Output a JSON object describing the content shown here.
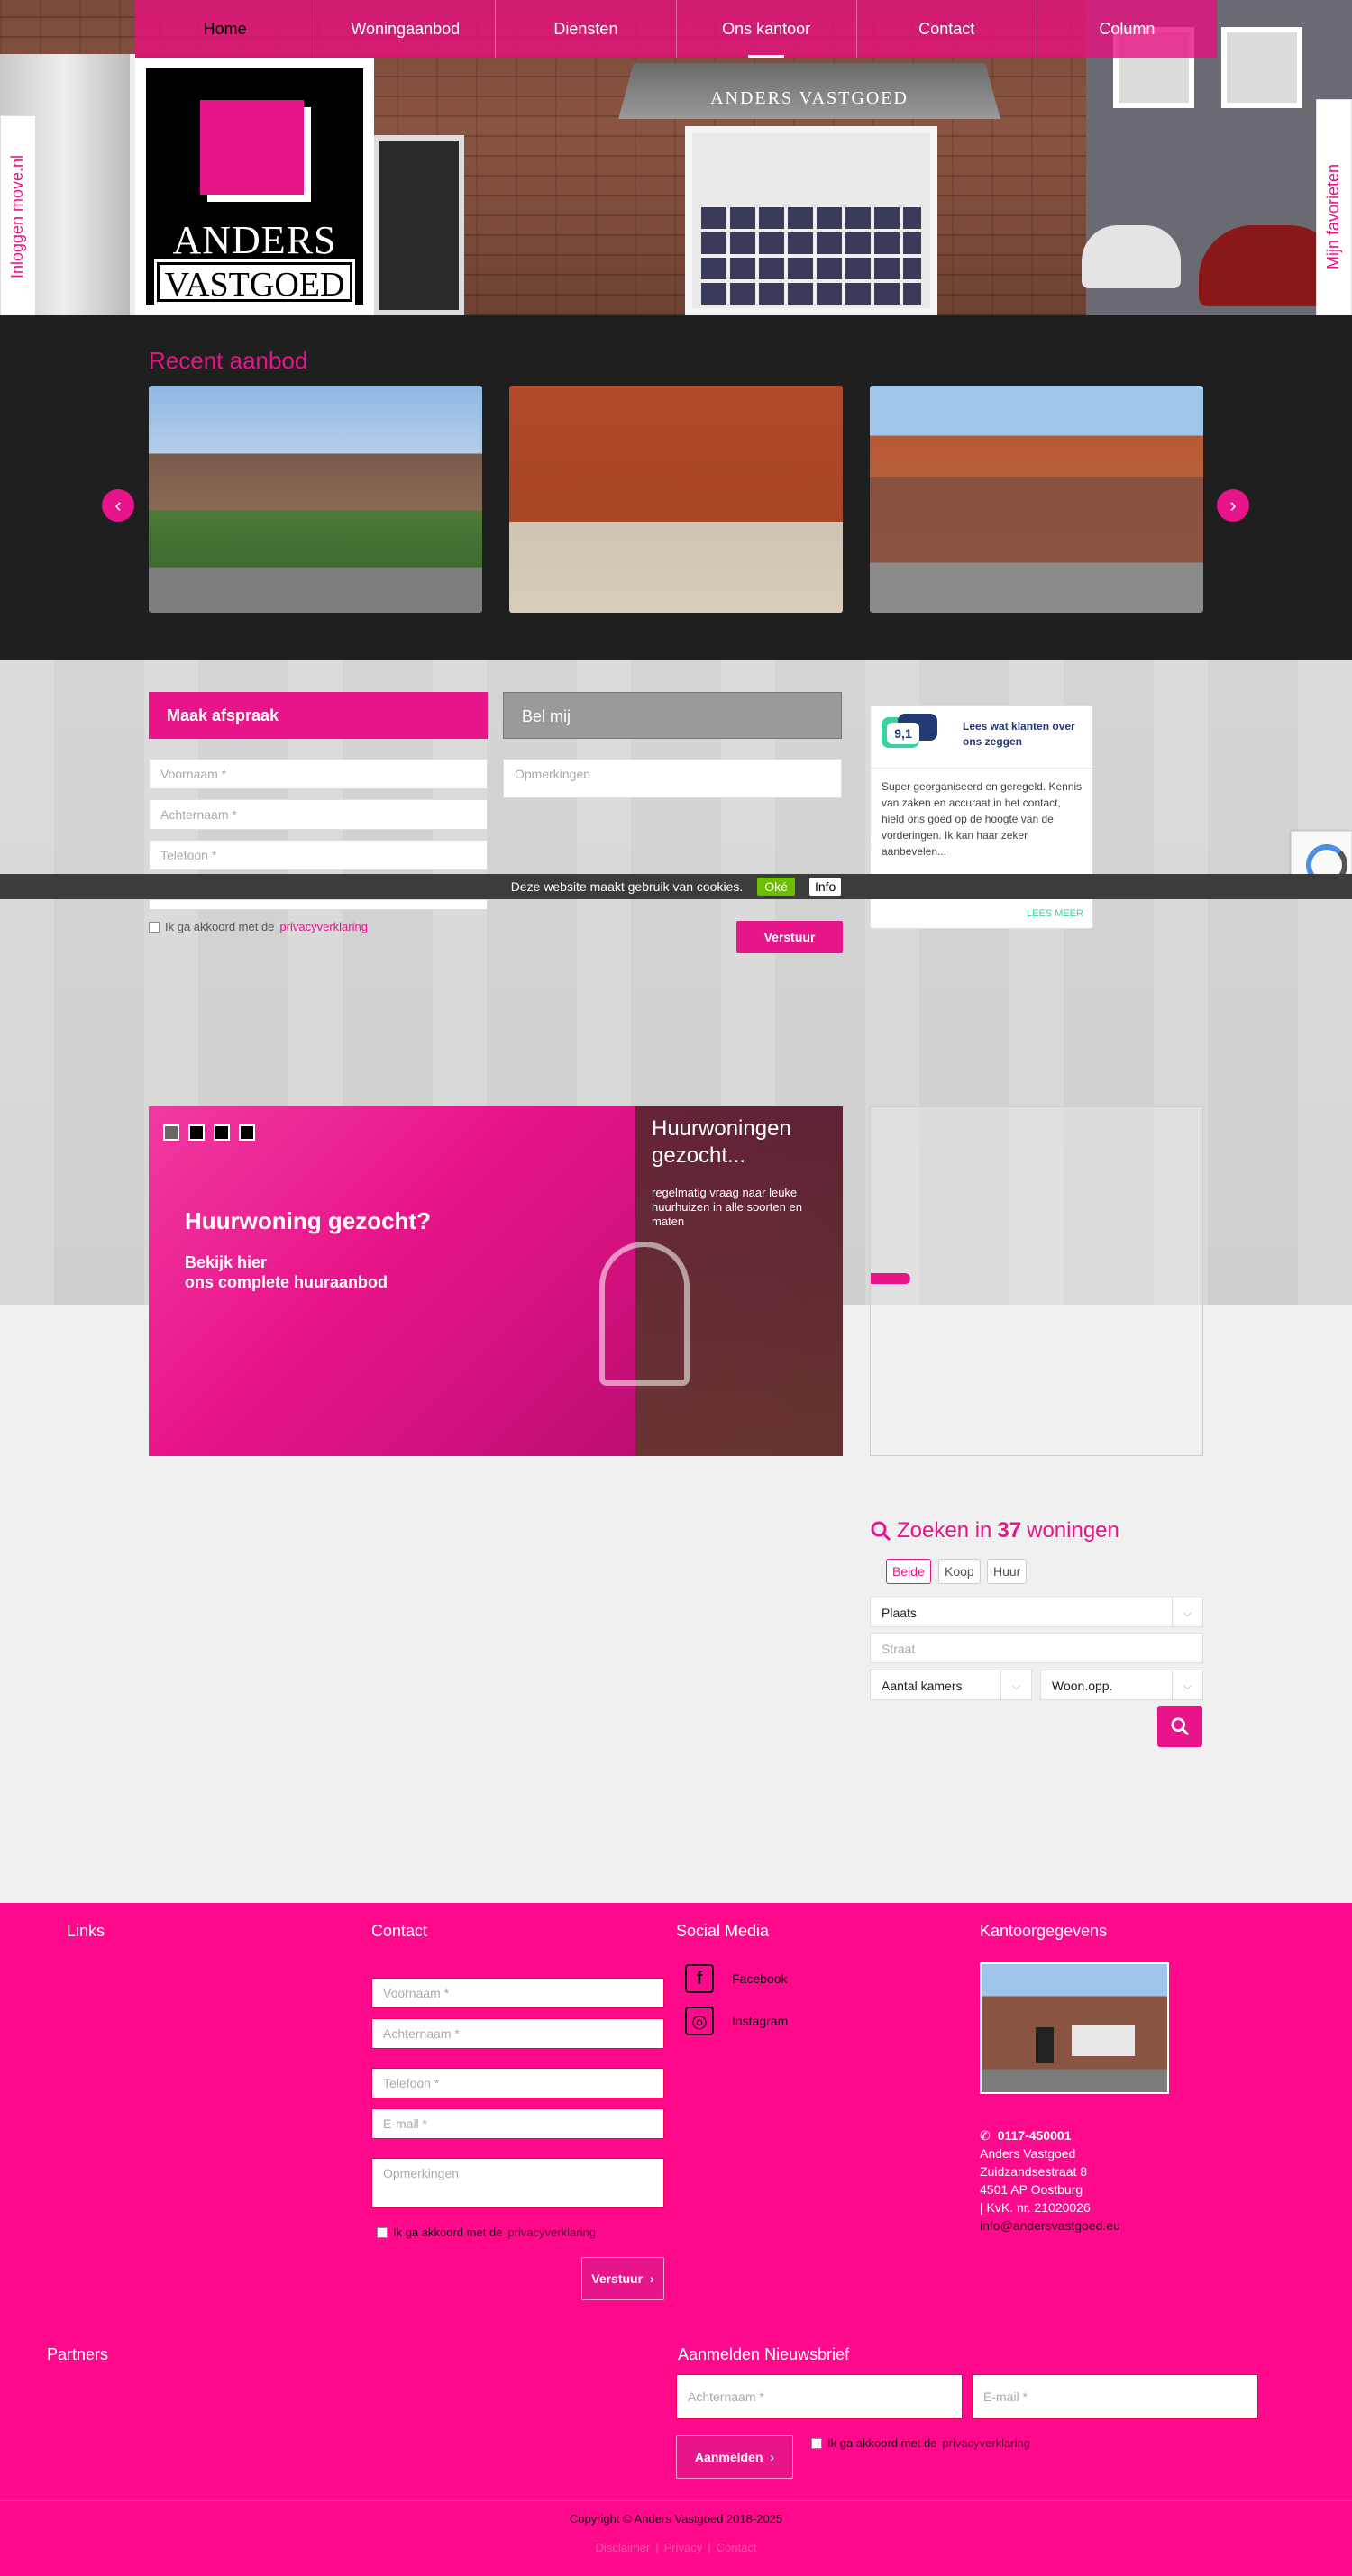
{
  "nav": {
    "items": [
      {
        "label": "Home"
      },
      {
        "label": "Woningaanbod"
      },
      {
        "label": "Diensten"
      },
      {
        "label": "Ons kantoor"
      },
      {
        "label": "Contact"
      },
      {
        "label": "Column"
      }
    ]
  },
  "logo": {
    "line1": "ANDERS",
    "line2": "VASTGOED"
  },
  "hero": {
    "awning_text": "ANDERS VASTGOED"
  },
  "side": {
    "left": "Inloggen move.nl",
    "right": "Mijn favorieten"
  },
  "recent": {
    "title": "Recent aanbod",
    "prev": "‹",
    "next": "›"
  },
  "appointment": {
    "tab_afspraak": "Maak afspraak",
    "tab_belmij": "Bel mij",
    "voornaam": "Voornaam *",
    "achternaam": "Achternaam *",
    "telefoon": "Telefoon *",
    "opmerkingen": "Opmerkingen",
    "agree_prefix": "Ik ga akkoord met de",
    "agree_link": "privacyverklaring",
    "submit": "Verstuur"
  },
  "review": {
    "score": "9,1",
    "title": "Lees wat klanten over ons zeggen",
    "text": "Super georganiseerd en geregeld. Kennis van zaken en accuraat in het contact, hield ons goed op de hoogte van de vorderingen. Ik kan haar zeker aanbevelen...",
    "more": "LEES MEER"
  },
  "cookie": {
    "text": "Deze website maakt gebruik van cookies.",
    "ok": "Oké",
    "info": "Info"
  },
  "banner": {
    "headline": "Huurwoning gezocht?",
    "sub1": "Bekijk hier",
    "sub2": "ons complete huuraanbod",
    "right_title": "Huurwoningen gezocht...",
    "right_text": "regelmatig vraag naar leuke huurhuizen in alle soorten en maten"
  },
  "search": {
    "prefix": "Zoeken in",
    "count": "37",
    "suffix": "woningen",
    "types": [
      "Beide",
      "Koop",
      "Huur"
    ],
    "plaats": "Plaats",
    "straat": "Straat",
    "kamers": "Aantal kamers",
    "woonopp": "Woon.opp."
  },
  "footer": {
    "links_title": "Links",
    "contact_title": "Contact",
    "social_title": "Social Media",
    "office_title": "Kantoorgegevens",
    "voornaam": "Voornaam *",
    "achternaam": "Achternaam *",
    "telefoon": "Telefoon *",
    "email": "E-mail *",
    "opmerkingen": "Opmerkingen",
    "agree_prefix": "Ik ga akkoord met de",
    "agree_link": "privacyverklaring",
    "submit": "Verstuur",
    "facebook": "Facebook",
    "instagram": "Instagram",
    "phone": "0117-450001",
    "company": "Anders Vastgoed",
    "street": "Zuidzandsestraat 8",
    "city": "4501 AP Oostburg",
    "kvk": "| KvK. nr. 21020026",
    "email_addr": "info@andersvastgoed.eu",
    "partners_title": "Partners",
    "newsletter_title": "Aanmelden Nieuwsbrief",
    "nl_achternaam": "Achternaam *",
    "nl_email": "E-mail *",
    "nl_agree_prefix": "Ik ga akkoord met de",
    "nl_agree_link": "privacyverklaring",
    "nl_submit": "Aanmelden",
    "copyright": "Copyright © Anders Vastgoed 2018-2025",
    "disclaimer": "Disclaimer",
    "privacy": "Privacy",
    "contact_link": "Contact"
  },
  "colors": {
    "brand": "#e8158a",
    "footer": "#ff0a8c",
    "dark": "#1f1f1f"
  }
}
